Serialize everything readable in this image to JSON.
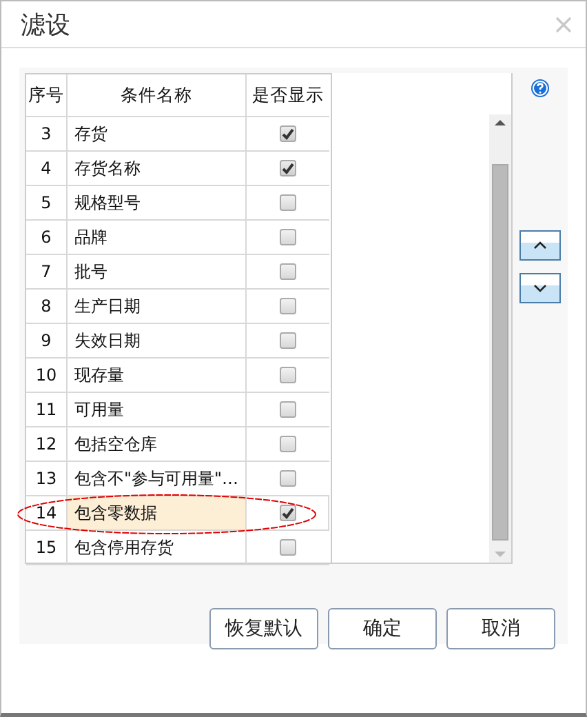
{
  "window": {
    "title": "滤设"
  },
  "table": {
    "columns": [
      "序号",
      "条件名称",
      "是否显示"
    ],
    "rows": [
      {
        "index": "3",
        "name": "存货",
        "shown": true,
        "selected": false,
        "circled": false
      },
      {
        "index": "4",
        "name": "存货名称",
        "shown": true,
        "selected": false,
        "circled": false
      },
      {
        "index": "5",
        "name": "规格型号",
        "shown": false,
        "selected": false,
        "circled": false
      },
      {
        "index": "6",
        "name": "品牌",
        "shown": false,
        "selected": false,
        "circled": false
      },
      {
        "index": "7",
        "name": "批号",
        "shown": false,
        "selected": false,
        "circled": false
      },
      {
        "index": "8",
        "name": "生产日期",
        "shown": false,
        "selected": false,
        "circled": false
      },
      {
        "index": "9",
        "name": "失效日期",
        "shown": false,
        "selected": false,
        "circled": false
      },
      {
        "index": "10",
        "name": "现存量",
        "shown": false,
        "selected": false,
        "circled": false
      },
      {
        "index": "11",
        "name": "可用量",
        "shown": false,
        "selected": false,
        "circled": false
      },
      {
        "index": "12",
        "name": "包括空仓库",
        "shown": false,
        "selected": false,
        "circled": false
      },
      {
        "index": "13",
        "name": "包含不\"参与可用量\"…",
        "shown": false,
        "selected": false,
        "circled": false
      },
      {
        "index": "14",
        "name": "包含零数据",
        "shown": true,
        "selected": true,
        "circled": true
      },
      {
        "index": "15",
        "name": "包含停用存货",
        "shown": false,
        "selected": false,
        "circled": false
      }
    ]
  },
  "buttons": [
    "恢复默认",
    "确定",
    "取消"
  ]
}
